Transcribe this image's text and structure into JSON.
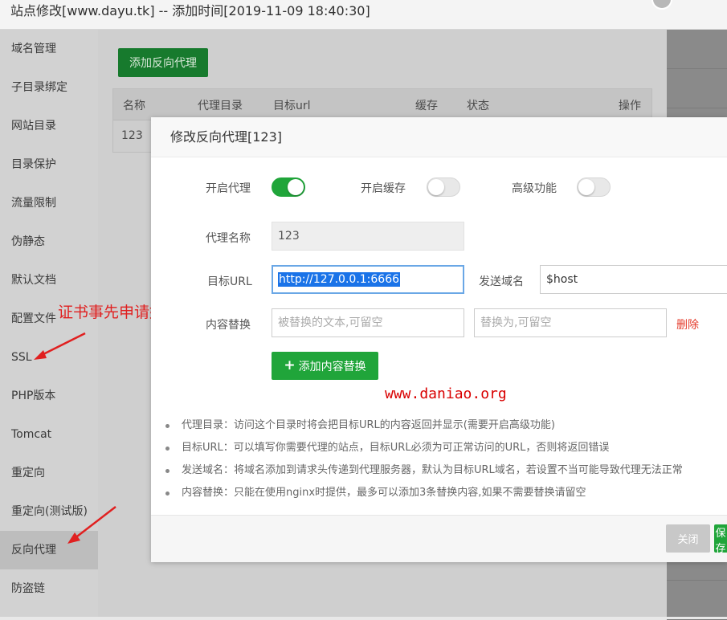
{
  "window": {
    "title": "站点修改[www.dayu.tk] -- 添加时间[2019-11-09 18:40:30]"
  },
  "sidebar": {
    "items": [
      {
        "label": "域名管理"
      },
      {
        "label": "子目录绑定"
      },
      {
        "label": "网站目录"
      },
      {
        "label": "目录保护"
      },
      {
        "label": "流量限制"
      },
      {
        "label": "伪静态"
      },
      {
        "label": "默认文档"
      },
      {
        "label": "配置文件"
      },
      {
        "label": "SSL"
      },
      {
        "label": "PHP版本"
      },
      {
        "label": "Tomcat"
      },
      {
        "label": "重定向"
      },
      {
        "label": "重定向(测试版)"
      },
      {
        "label": "反向代理"
      },
      {
        "label": "防盗链"
      }
    ],
    "active_index": 13
  },
  "background_panel": {
    "add_button": "添加反向代理",
    "table": {
      "columns": [
        "名称",
        "代理目录",
        "目标url",
        "缓存",
        "状态",
        "操作"
      ],
      "rows": [
        [
          "123"
        ]
      ]
    }
  },
  "annotation": {
    "text": "证书事先申请好",
    "color": "#e02020"
  },
  "modal": {
    "title": "修改反向代理[123]",
    "toggles": [
      {
        "label": "开启代理",
        "on": true
      },
      {
        "label": "开启缓存",
        "on": false
      },
      {
        "label": "高级功能",
        "on": false
      }
    ],
    "proxy_name": {
      "label": "代理名称",
      "value": "123"
    },
    "target_url": {
      "label": "目标URL",
      "value": "http://127.0.0.1:6666"
    },
    "send_domain": {
      "label": "发送域名",
      "value": "$host"
    },
    "content_replace": {
      "label": "内容替换",
      "from_placeholder": "被替换的文本,可留空",
      "to_placeholder": "替换为,可留空",
      "delete_label": "删除"
    },
    "add_replace_button": "添加内容替换",
    "watermark": "www.daniao.org",
    "tips": [
      "代理目录：访问这个目录时将会把目标URL的内容返回并显示(需要开启高级功能)",
      "目标URL：可以填写你需要代理的站点，目标URL必须为可正常访问的URL，否则将返回错误",
      "发送域名：将域名添加到请求头传递到代理服务器，默认为目标URL域名，若设置不当可能导致代理无法正常",
      "内容替换：只能在使用nginx时提供，最多可以添加3条替换内容,如果不需要替换请留空"
    ],
    "footer": {
      "close_label": "关闭",
      "save_label": "保存"
    }
  },
  "colors": {
    "accent_green": "#20a53a",
    "danger_red": "#e43b2b",
    "focus_blue": "#6aa7e6"
  }
}
